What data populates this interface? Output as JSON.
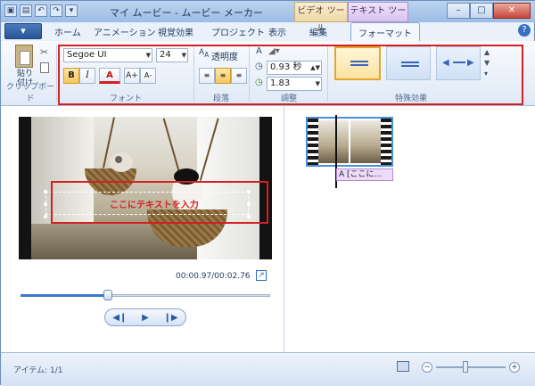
{
  "titlebar": {
    "title": "マイ ムービー - ムービー メーカー",
    "context_video": "ビデオ ツール",
    "context_text": "テキスト ツール",
    "minimize": "–",
    "maximize": "□",
    "close": "✕"
  },
  "tabs": [
    "ホーム",
    "アニメーション",
    "視覚効果",
    "プロジェクト",
    "表示",
    "編集",
    "フォーマット"
  ],
  "help_label": "?",
  "ribbon": {
    "paste_label": "貼り付け",
    "clipboard_group": "クリップボード",
    "font_name": "Segoe UI",
    "font_size": "24",
    "bold": "B",
    "italic": "I",
    "font_color": "A",
    "grow_font": "A+",
    "shrink_font": "A-",
    "font_group": "フォント",
    "transparency_label": "透明度",
    "paragraph_group": "段落",
    "start_time": "0.93 秒",
    "duration": "1.83",
    "adjust_group": "調整",
    "effects_group": "特殊効果"
  },
  "preview": {
    "overlay_text": "ここにテキストを入力",
    "timecode": "00:00.97/00:02.76",
    "progress": 0.35
  },
  "storyboard": {
    "caption": "A [ここに…"
  },
  "status": {
    "items_label": "アイテム: 1/1",
    "zoom_out": "−",
    "zoom_in": "+"
  },
  "colors": {
    "highlight_box": "#d42020",
    "selected_effect": "#e3a52c",
    "text_caption": "#eddcf8"
  }
}
